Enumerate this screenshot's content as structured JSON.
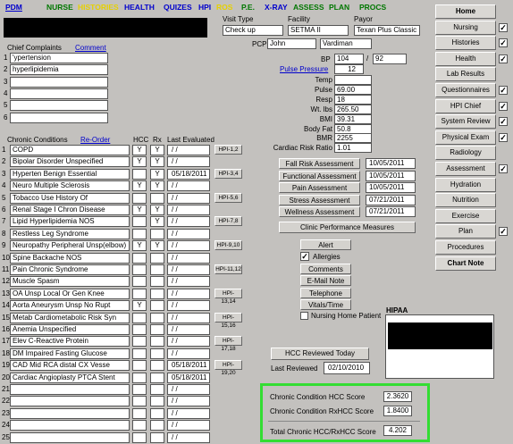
{
  "menu": [
    "PDM",
    "NURSE",
    "HISTORIES",
    "HEALTH",
    "QUIZES",
    "HPI",
    "ROS",
    "P.E.",
    "X-RAY",
    "ASSESS",
    "PLAN",
    "PROCS"
  ],
  "colors": {
    "PDM": "#0000cc",
    "NURSE": "#007700",
    "HISTORIES": "#e6d000",
    "HEALTH": "#0000cc",
    "QUIZES": "#0000cc",
    "HPI": "#0000cc",
    "ROS": "#e6d000",
    "P.E.": "#007700",
    "X-RAY": "#0000cc",
    "ASSESS": "#007700",
    "PLAN": "#007700",
    "PROCS": "#007700",
    "highlight": "#33dd33"
  },
  "visit": {
    "type_label": "Visit Type",
    "type": "Check up",
    "facility_label": "Facility",
    "facility": "SETMA II",
    "payor_label": "Payor",
    "payor": "Texan Plus Classic",
    "pcp_label": "PCP",
    "pcp_first": "John",
    "pcp_last": "Vardiman"
  },
  "complaints": {
    "label": "Chief Complaints",
    "comment_link": "Comment",
    "items": [
      "'ypertension",
      "hyperlipidemia",
      "",
      "",
      "",
      ""
    ]
  },
  "conditions": {
    "label": "Chronic Conditions",
    "reorder": "Re-Order",
    "hcc_h": "HCC",
    "rx_h": "Rx",
    "eval_h": "Last Evaluated",
    "rows": [
      {
        "name": "COPD",
        "hcc": "Y",
        "rx": "Y",
        "date": "/ /",
        "hpi": "HPI-1,2"
      },
      {
        "name": "Bipolar Disorder Unspecified",
        "hcc": "Y",
        "rx": "Y",
        "date": "/ /",
        "hpi": ""
      },
      {
        "name": "Hyperten  Benign Essential",
        "hcc": "",
        "rx": "Y",
        "date": "05/18/2011",
        "hpi": "HPI-3,4"
      },
      {
        "name": "Neuro  Multiple Sclerosis",
        "hcc": "Y",
        "rx": "Y",
        "date": "/ /",
        "hpi": ""
      },
      {
        "name": "Tobacco Use History Of",
        "hcc": "",
        "rx": "",
        "date": "/ /",
        "hpi": "HPI-5,6"
      },
      {
        "name": "Renal  Stage I Chron Disease",
        "hcc": "Y",
        "rx": "Y",
        "date": "/ /",
        "hpi": ""
      },
      {
        "name": "Lipid Hyperlipidemia NOS",
        "hcc": "",
        "rx": "Y",
        "date": "/ /",
        "hpi": "HPI-7,8"
      },
      {
        "name": "Restless Leg Syndrome",
        "hcc": "",
        "rx": "",
        "date": "/ /",
        "hpi": ""
      },
      {
        "name": "Neuropathy Peripheral Unsp(elbow)",
        "hcc": "Y",
        "rx": "Y",
        "date": "/ /",
        "hpi": "HPI-9,10"
      },
      {
        "name": "Spine Backache NOS",
        "hcc": "",
        "rx": "",
        "date": "/ /",
        "hpi": ""
      },
      {
        "name": "Pain Chronic Syndrome",
        "hcc": "",
        "rx": "",
        "date": "/ /",
        "hpi": "HPI-11,12"
      },
      {
        "name": "Muscle Spasm",
        "hcc": "",
        "rx": "",
        "date": "/ /",
        "hpi": ""
      },
      {
        "name": "OA Unsp Local Or Gen Knee",
        "hcc": "",
        "rx": "",
        "date": "/ /",
        "hpi": "HPI-13,14"
      },
      {
        "name": "Aorta Aneurysm Unsp No Rupt",
        "hcc": "Y",
        "rx": "",
        "date": "/ /",
        "hpi": ""
      },
      {
        "name": "Metab Cardiometabolic Risk Syn",
        "hcc": "",
        "rx": "",
        "date": "/ /",
        "hpi": "HPI-15,16"
      },
      {
        "name": "Anemia  Unspecified",
        "hcc": "",
        "rx": "",
        "date": "/ /",
        "hpi": ""
      },
      {
        "name": "Elev C-Reactive Protein",
        "hcc": "",
        "rx": "",
        "date": "/ /",
        "hpi": "HPI-17,18"
      },
      {
        "name": "DM Impaired Fasting Glucose",
        "hcc": "",
        "rx": "",
        "date": "/ /",
        "hpi": ""
      },
      {
        "name": "CAD Mid RCA distal CX  Vesse",
        "hcc": "",
        "rx": "",
        "date": "05/18/2011",
        "hpi": "HPI-19,20"
      },
      {
        "name": "Cardiac Angioplasty PTCA Stent",
        "hcc": "",
        "rx": "",
        "date": "05/18/2011",
        "hpi": ""
      },
      {
        "name": "",
        "hcc": "",
        "rx": "",
        "date": "/ /",
        "hpi": ""
      },
      {
        "name": "",
        "hcc": "",
        "rx": "",
        "date": "/ /",
        "hpi": ""
      },
      {
        "name": "",
        "hcc": "",
        "rx": "",
        "date": "/ /",
        "hpi": ""
      },
      {
        "name": "",
        "hcc": "",
        "rx": "",
        "date": "/ /",
        "hpi": ""
      },
      {
        "name": "",
        "hcc": "",
        "rx": "",
        "date": "/ /",
        "hpi": ""
      }
    ]
  },
  "vitals": {
    "bp_label": "BP",
    "bp_sys": "104",
    "bp_dia": "92",
    "pulse_pressure_label": "Pulse Pressure",
    "pulse_pressure": "12",
    "items": [
      {
        "label": "Temp",
        "value": ""
      },
      {
        "label": "Pulse",
        "value": "69.00"
      },
      {
        "label": "Resp",
        "value": "18"
      },
      {
        "label": "Wt. lbs",
        "value": "265.50"
      },
      {
        "label": "BMI",
        "value": "39.31"
      },
      {
        "label": "Body Fat",
        "value": "50.8"
      },
      {
        "label": "BMR",
        "value": "2255"
      },
      {
        "label": "Cardiac Risk Ratio",
        "value": "1.01"
      }
    ]
  },
  "assessments": [
    {
      "label": "Fall Risk Assessment",
      "date": "10/05/2011"
    },
    {
      "label": "Functional Assessment",
      "date": "10/05/2011"
    },
    {
      "label": "Pain Assessment",
      "date": "10/05/2011"
    },
    {
      "label": "Stress Assessment",
      "date": "07/21/2011"
    },
    {
      "label": "Wellness Assessment",
      "date": "07/21/2011"
    }
  ],
  "clinic_perf": "Clinic Performance Measures",
  "alert": "Alert",
  "allergies": "Allergies",
  "mid_buttons": [
    "Comments",
    "E-Mail Note",
    "Telephone",
    "Vitals/Time"
  ],
  "nursing_home": "Nursing Home Patient",
  "hipaa": "HIPAA",
  "hcc_reviewed": {
    "button": "HCC Reviewed Today",
    "label": "Last Reviewed",
    "date": "02/10/2010"
  },
  "scores": [
    {
      "label": "Chronic Condition HCC Score",
      "value": "2.3620"
    },
    {
      "label": "Chronic Condition RxHCC Score",
      "value": "1.8400"
    },
    {
      "label": "Total Chronic HCC/RxHCC Score",
      "value": "4.202"
    }
  ],
  "right_nav": [
    {
      "label": "Home",
      "bold": true,
      "check": false
    },
    {
      "label": "Nursing",
      "bold": false,
      "check": true
    },
    {
      "label": "Histories",
      "bold": false,
      "check": true
    },
    {
      "label": "Health",
      "bold": false,
      "check": true
    },
    {
      "label": "Lab Results",
      "bold": false,
      "check": false
    },
    {
      "label": "Questionnaires",
      "bold": false,
      "check": true
    },
    {
      "label": "HPI Chief",
      "bold": false,
      "check": true
    },
    {
      "label": "System Review",
      "bold": false,
      "check": true
    },
    {
      "label": "Physical Exam",
      "bold": false,
      "check": true
    },
    {
      "label": "Radiology",
      "bold": false,
      "check": false
    },
    {
      "label": "Assessment",
      "bold": false,
      "check": true
    },
    {
      "label": "Hydration",
      "bold": false,
      "check": false
    },
    {
      "label": "Nutrition",
      "bold": false,
      "check": false
    },
    {
      "label": "Exercise",
      "bold": false,
      "check": false
    },
    {
      "label": "Plan",
      "bold": false,
      "check": true
    },
    {
      "label": "Procedures",
      "bold": false,
      "check": false
    },
    {
      "label": "Chart Note",
      "bold": true,
      "check": false
    }
  ],
  "check_glyph": "✓"
}
